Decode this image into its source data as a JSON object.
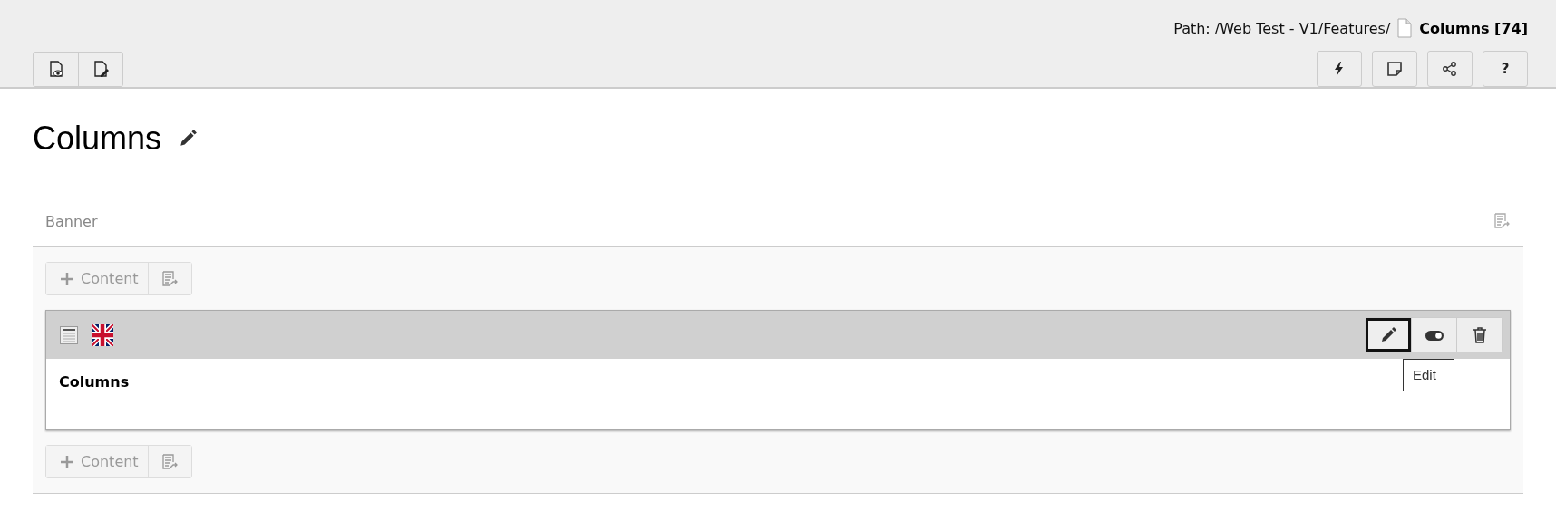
{
  "header": {
    "path": "Path: /Web Test - V1/Features/",
    "page": "Columns [74]",
    "left_buttons": [
      {
        "kind": "view"
      },
      {
        "kind": "edit"
      }
    ],
    "right_buttons": [
      {
        "kind": "flash"
      },
      {
        "kind": "note"
      },
      {
        "kind": "share"
      },
      {
        "kind": "help",
        "label": "?"
      }
    ]
  },
  "title": "Columns",
  "section": {
    "label": "Banner",
    "items": [
      {
        "kind": "add",
        "label": "Content"
      },
      {
        "kind": "element",
        "content": "Columns",
        "actions": [
          {
            "kind": "edit",
            "focused": true
          },
          {
            "kind": "toggle",
            "on": true,
            "focused": false
          },
          {
            "kind": "delete",
            "focused": false
          }
        ],
        "tooltip": "Edit"
      },
      {
        "kind": "add",
        "label": "Content"
      }
    ]
  }
}
